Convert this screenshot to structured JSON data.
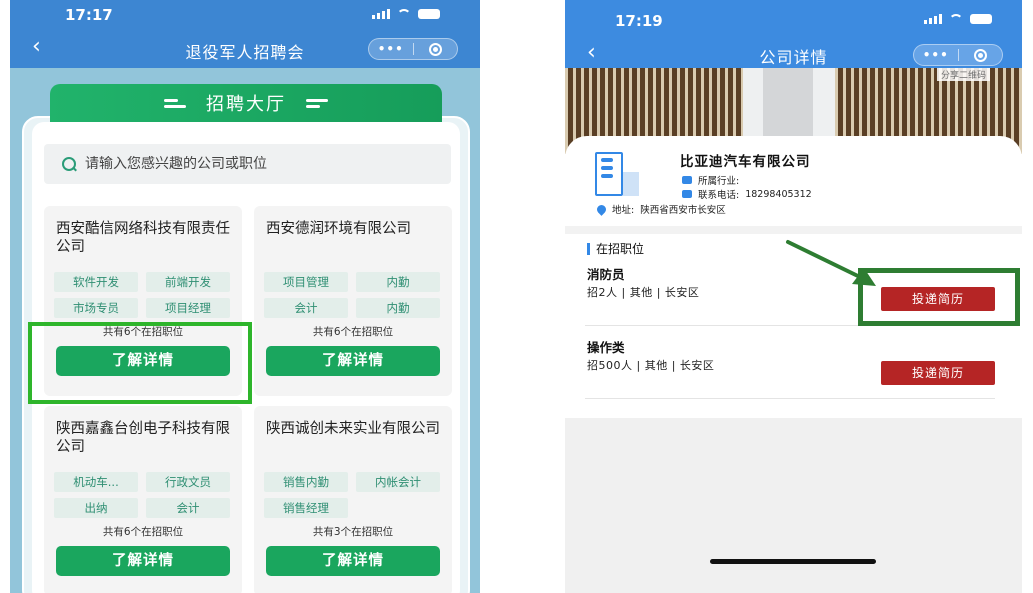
{
  "left": {
    "status_time": "17:17",
    "nav_title": "退役军人招聘会",
    "capsule_more": "•••",
    "hall_title": "招聘大厅",
    "search": {
      "placeholder": "请输入您感兴趣的公司或职位"
    },
    "companies": [
      {
        "name": "西安酷信网络科技有限责任公司",
        "tags": [
          "软件开发",
          "前端开发",
          "市场专员",
          "项目经理"
        ],
        "count": "共有6个在招职位",
        "button": "了解详情"
      },
      {
        "name": "西安德润环境有限公司",
        "tags": [
          "项目管理",
          "内勤",
          "会计",
          "内勤"
        ],
        "count": "共有6个在招职位",
        "button": "了解详情"
      },
      {
        "name": "陕西嘉鑫台创电子科技有限公司",
        "tags": [
          "机动车...",
          "行政文员",
          "出纳",
          "会计"
        ],
        "count": "共有6个在招职位",
        "button": "了解详情"
      },
      {
        "name": "陕西诚创未来实业有限公司",
        "tags": [
          "销售内勤",
          "内帐会计",
          "销售经理"
        ],
        "count": "共有3个在招职位",
        "button": "了解详情"
      }
    ]
  },
  "right": {
    "status_time": "17:19",
    "nav_title": "公司详情",
    "capsule_more": "•••",
    "share": "分享二维码",
    "company": {
      "name": "比亚迪汽车有限公司",
      "industry_label": "所属行业:",
      "industry_value": "",
      "phone_label": "联系电话:",
      "phone_value": "18298405312",
      "address_label": "地址:",
      "address_value": "陕西省西安市长安区"
    },
    "section_title": "在招职位",
    "jobs": [
      {
        "title": "消防员",
        "meta": "招2人 | 其他 | 长安区",
        "button": "投递简历"
      },
      {
        "title": "操作类",
        "meta": "招500人 | 其他 | 长安区",
        "button": "投递简历"
      }
    ]
  },
  "colors": {
    "brand_blue": "#3d86d2",
    "accent_green": "#1aa65e",
    "apply_red": "#b52525",
    "highlight_green": "#2eb52b"
  }
}
